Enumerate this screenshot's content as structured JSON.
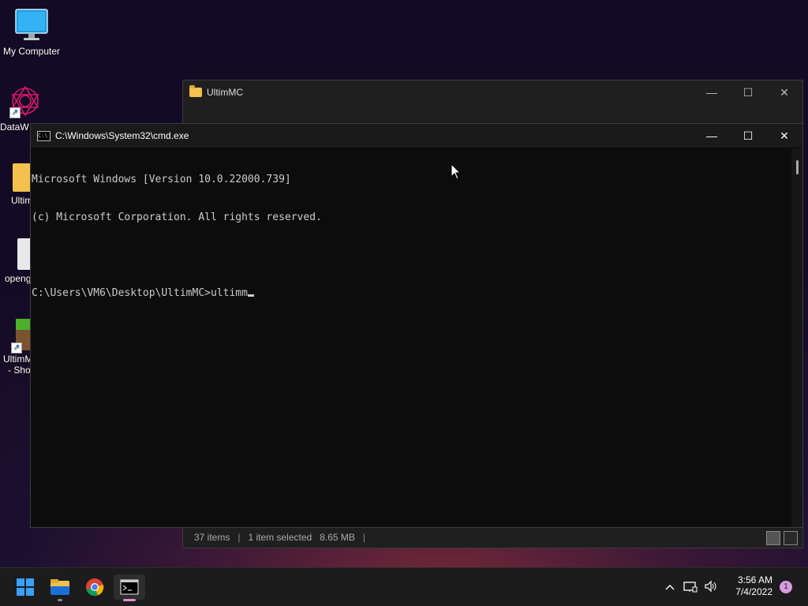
{
  "desktop": {
    "icons": [
      {
        "label": "My Computer",
        "icon": "monitor-icon"
      },
      {
        "label": "DataW",
        "icon": "datawrapper-icon"
      },
      {
        "label": "Ultim",
        "icon": "folder-icon"
      },
      {
        "label": "openg",
        "icon": "file-icon"
      },
      {
        "label_line1": "UltimM",
        "label_line2": "- Sho",
        "icon": "minecraft-icon"
      }
    ]
  },
  "explorer": {
    "title": "UltimMC",
    "status": {
      "items": "37 items",
      "selected": "1 item selected",
      "size": "8.65 MB",
      "sep": "|"
    }
  },
  "cmd": {
    "title": "C:\\Windows\\System32\\cmd.exe",
    "lines": [
      "Microsoft Windows [Version 10.0.22000.739]",
      "(c) Microsoft Corporation. All rights reserved.",
      "",
      "C:\\Users\\VM6\\Desktop\\UltimMC>ultimm"
    ]
  },
  "window_controls": {
    "minimize": "—",
    "maximize": "☐",
    "close": "✕"
  },
  "taskbar": {
    "apps": [
      "start-icon",
      "file-explorer-icon",
      "chrome-icon",
      "terminal-icon"
    ],
    "clock": {
      "time": "3:56 AM",
      "date": "7/4/2022"
    },
    "notifications": "1",
    "colors": {
      "accent": "#e08fd0",
      "start": "#3aa0ff"
    }
  }
}
